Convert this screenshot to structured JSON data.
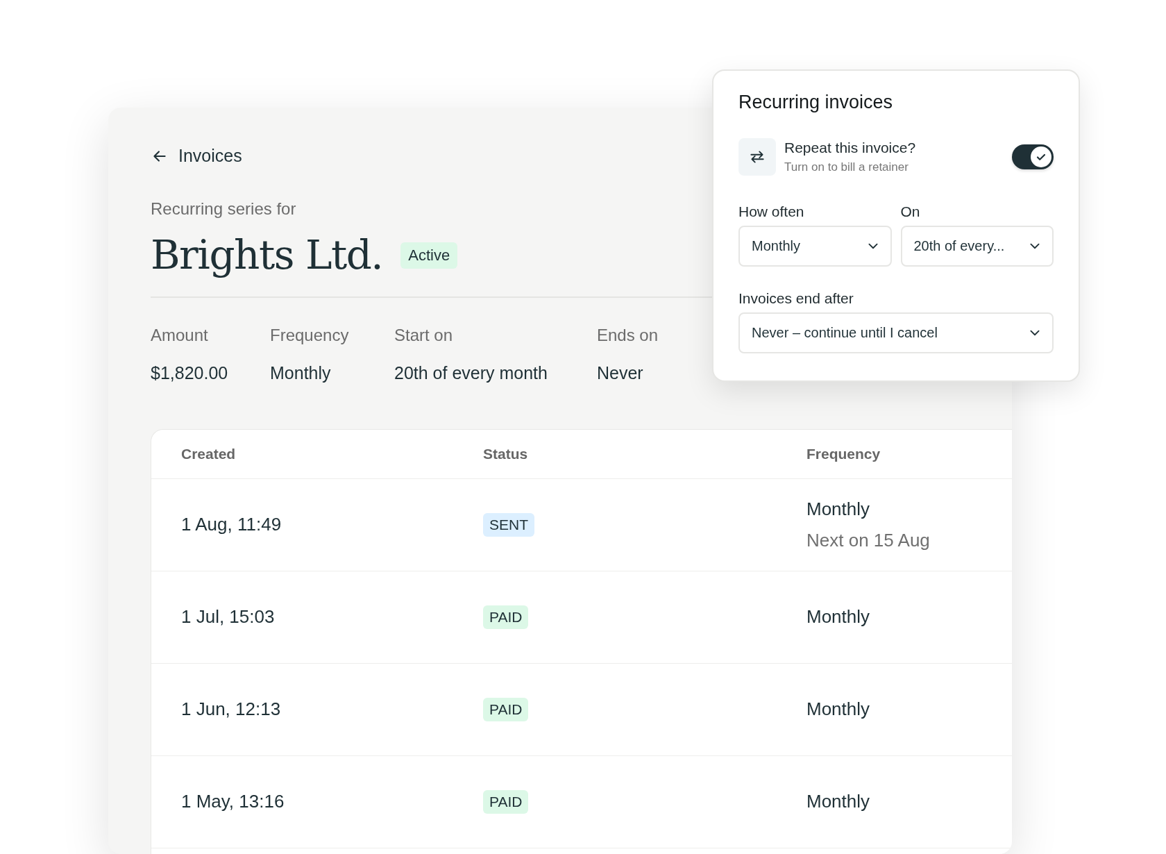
{
  "back_link": {
    "label": "Invoices"
  },
  "header": {
    "subtitle": "Recurring series for",
    "title": "Brights Ltd.",
    "badge": {
      "label": "Active",
      "kind": "active"
    }
  },
  "summary": [
    {
      "label": "Amount",
      "value": "$1,820.00"
    },
    {
      "label": "Frequency",
      "value": "Monthly"
    },
    {
      "label": "Start on",
      "value": "20th of every month"
    },
    {
      "label": "Ends on",
      "value": "Never"
    }
  ],
  "table": {
    "columns": [
      "Created",
      "Status",
      "Frequency"
    ],
    "rows": [
      {
        "created": "1 Aug, 11:49",
        "status": {
          "label": "SENT",
          "kind": "sent"
        },
        "frequency": "Monthly",
        "note": "Next on 15 Aug"
      },
      {
        "created": "1 Jul, 15:03",
        "status": {
          "label": "PAID",
          "kind": "paid"
        },
        "frequency": "Monthly"
      },
      {
        "created": "1 Jun, 12:13",
        "status": {
          "label": "PAID",
          "kind": "paid"
        },
        "frequency": "Monthly"
      },
      {
        "created": "1 May, 13:16",
        "status": {
          "label": "PAID",
          "kind": "paid"
        },
        "frequency": "Monthly"
      }
    ]
  },
  "popup": {
    "title": "Recurring invoices",
    "repeat": {
      "label": "Repeat this invoice?",
      "hint": "Turn on to bill a retainer",
      "on": true
    },
    "how_often": {
      "label": "How often",
      "value": "Monthly"
    },
    "on": {
      "label": "On",
      "value": "20th of every..."
    },
    "end_after": {
      "label": "Invoices end after",
      "value": "Never – continue until I cancel"
    }
  }
}
